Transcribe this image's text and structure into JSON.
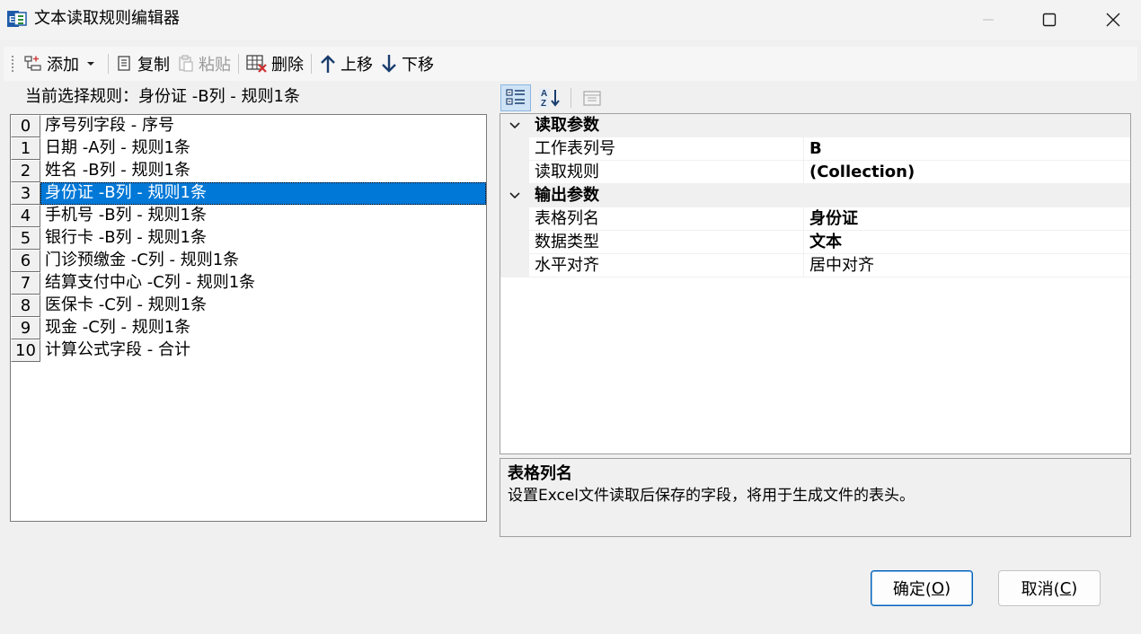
{
  "window": {
    "title": "文本读取规则编辑器",
    "icon": "excel-icon"
  },
  "toolbar": {
    "add_label": "添加",
    "copy_label": "复制",
    "paste_label": "粘贴",
    "delete_label": "删除",
    "move_up_label": "上移",
    "move_down_label": "下移"
  },
  "current_rule": {
    "label": "当前选择规则：身份证 -B列 - 规则1条"
  },
  "rules": [
    {
      "index": "0",
      "text": "序号列字段 - 序号"
    },
    {
      "index": "1",
      "text": "日期 -A列 - 规则1条"
    },
    {
      "index": "2",
      "text": "姓名 -B列 - 规则1条"
    },
    {
      "index": "3",
      "text": "身份证 -B列 - 规则1条",
      "selected": true
    },
    {
      "index": "4",
      "text": "手机号 -B列 - 规则1条"
    },
    {
      "index": "5",
      "text": "银行卡 -B列 - 规则1条"
    },
    {
      "index": "6",
      "text": "门诊预缴金 -C列 - 规则1条"
    },
    {
      "index": "7",
      "text": "结算支付中心 -C列 - 规则1条"
    },
    {
      "index": "8",
      "text": "医保卡 -C列 - 规则1条"
    },
    {
      "index": "9",
      "text": "现金 -C列 - 规则1条"
    },
    {
      "index": "10",
      "text": "计算公式字段 - 合计"
    }
  ],
  "property_grid": {
    "categories": [
      {
        "label": "读取参数",
        "properties": [
          {
            "name": "工作表列号",
            "value": "B",
            "bold": true
          },
          {
            "name": "读取规则",
            "value": "(Collection)",
            "bold": true
          }
        ]
      },
      {
        "label": "输出参数",
        "properties": [
          {
            "name": "表格列名",
            "value": "身份证",
            "bold": true
          },
          {
            "name": "数据类型",
            "value": "文本",
            "bold": true
          },
          {
            "name": "水平对齐",
            "value": "居中对齐",
            "bold": false
          }
        ]
      }
    ]
  },
  "description": {
    "title": "表格列名",
    "text": "设置Excel文件读取后保存的字段，将用于生成文件的表头。"
  },
  "buttons": {
    "ok_label": "确定(",
    "ok_key": "O",
    "ok_end": ")",
    "cancel_label": "取消(",
    "cancel_key": "C",
    "cancel_end": ")"
  },
  "colors": {
    "selection": "#0078d7",
    "background": "#f0f0f0"
  }
}
